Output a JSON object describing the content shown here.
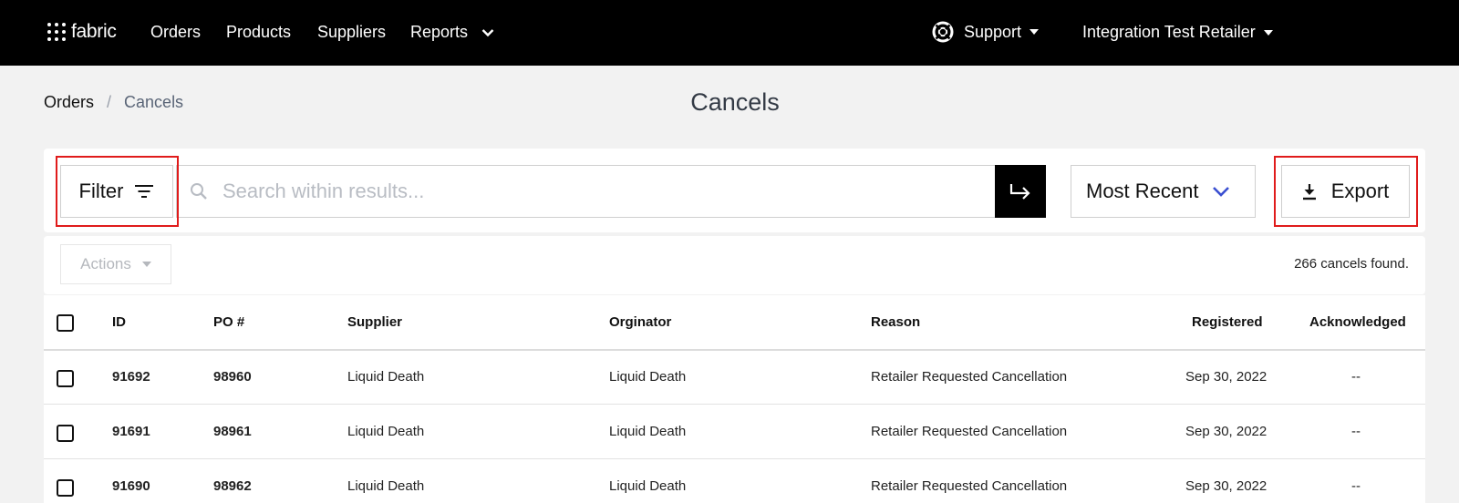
{
  "nav": {
    "logo_text": "fabric",
    "items": [
      "Orders",
      "Products",
      "Suppliers",
      "Reports"
    ],
    "support_label": "Support",
    "retailer_label": "Integration Test Retailer"
  },
  "breadcrumb": {
    "root": "Orders",
    "separator": "/",
    "current": "Cancels"
  },
  "page_title": "Cancels",
  "toolbar": {
    "filter_label": "Filter",
    "search_placeholder": "Search within results...",
    "sort_value": "Most Recent",
    "export_label": "Export"
  },
  "actions": {
    "label": "Actions",
    "count_text": "266 cancels found."
  },
  "table": {
    "columns": [
      "ID",
      "PO #",
      "Supplier",
      "Orginator",
      "Reason",
      "Registered",
      "Acknowledged"
    ],
    "rows": [
      {
        "id": "91692",
        "po": "98960",
        "supplier": "Liquid Death",
        "originator": "Liquid Death",
        "reason": "Retailer Requested Cancellation",
        "registered": "Sep 30, 2022",
        "acknowledged": "--"
      },
      {
        "id": "91691",
        "po": "98961",
        "supplier": "Liquid Death",
        "originator": "Liquid Death",
        "reason": "Retailer Requested Cancellation",
        "registered": "Sep 30, 2022",
        "acknowledged": "--"
      },
      {
        "id": "91690",
        "po": "98962",
        "supplier": "Liquid Death",
        "originator": "Liquid Death",
        "reason": "Retailer Requested Cancellation",
        "registered": "Sep 30, 2022",
        "acknowledged": "--"
      }
    ]
  },
  "colors": {
    "nav_bg": "#000000",
    "link": "#1f4fd8",
    "highlight": "#e01b1b",
    "page_bg": "#f2f2f2"
  }
}
